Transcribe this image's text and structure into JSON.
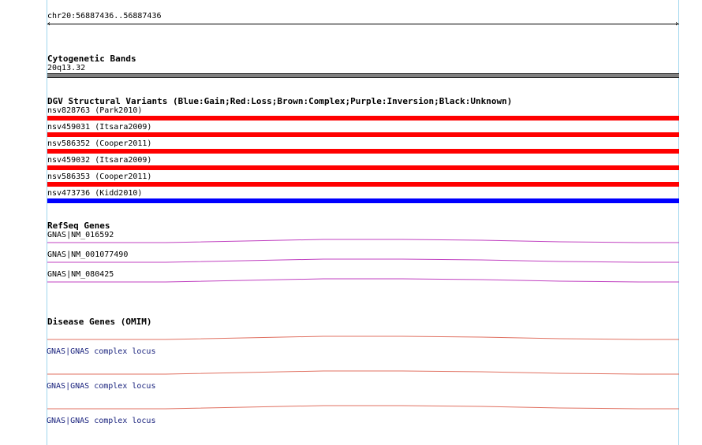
{
  "ruler": {
    "label": "chr20:56887436..56887436"
  },
  "cytogenetic": {
    "title": "Cytogenetic Bands",
    "band": "20q13.32",
    "color": "#808080"
  },
  "dgv": {
    "title": "DGV Structural Variants (Blue:Gain;Red:Loss;Brown:Complex;Purple:Inversion;Black:Unknown)",
    "variants": [
      {
        "label": "nsv828763 (Park2010)",
        "type": "Loss",
        "color": "#ff0000"
      },
      {
        "label": "nsv459031 (Itsara2009)",
        "type": "Loss",
        "color": "#ff0000"
      },
      {
        "label": "nsv586352 (Cooper2011)",
        "type": "Loss",
        "color": "#ff0000"
      },
      {
        "label": "nsv459032 (Itsara2009)",
        "type": "Loss",
        "color": "#ff0000"
      },
      {
        "label": "nsv586353 (Cooper2011)",
        "type": "Loss",
        "color": "#ff0000"
      },
      {
        "label": "nsv473736 (Kidd2010)",
        "type": "Gain",
        "color": "#0000ff"
      }
    ]
  },
  "refseq": {
    "title": "RefSeq Genes",
    "color": "#c040c0",
    "genes": [
      {
        "label": "GNAS|NM_016592"
      },
      {
        "label": "GNAS|NM_001077490"
      },
      {
        "label": "GNAS|NM_080425"
      }
    ]
  },
  "omim": {
    "title": "Disease Genes (OMIM)",
    "color": "#e07060",
    "label_color": "#1a237e",
    "genes": [
      {
        "label": "GNAS|GNAS complex locus"
      },
      {
        "label": "GNAS|GNAS complex locus"
      },
      {
        "label": "GNAS|GNAS complex locus"
      }
    ]
  }
}
